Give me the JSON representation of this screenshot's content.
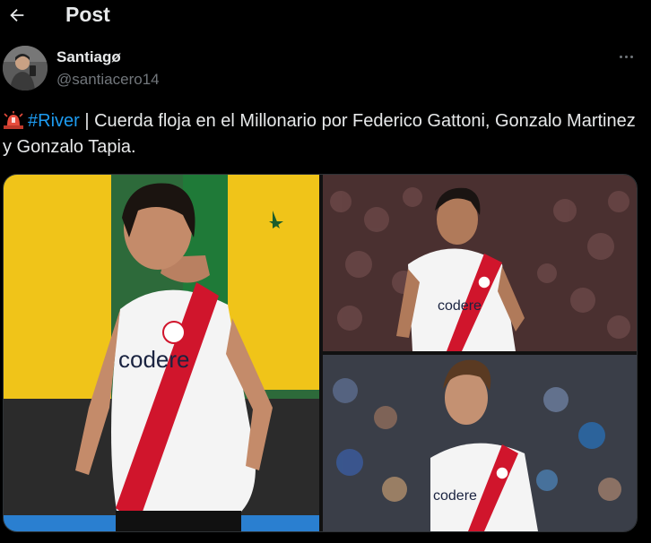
{
  "header": {
    "title": "Post"
  },
  "author": {
    "name": "Santiagø",
    "handle": "@santiacero14"
  },
  "tweet": {
    "hashtag": "#River",
    "text": " | Cuerda floja en el Millonario por Federico Gattoni, Gonzalo Martinez y Gonzalo Tapia."
  },
  "media": {
    "sponsor_text": "codere"
  },
  "colors": {
    "background": "#000000",
    "text": "#e7e9ea",
    "muted": "#71767b",
    "link": "#1d9bf0",
    "kit_red": "#d0152c"
  },
  "icons": [
    "back-arrow-icon",
    "more-options-icon",
    "siren-emoji-icon"
  ]
}
